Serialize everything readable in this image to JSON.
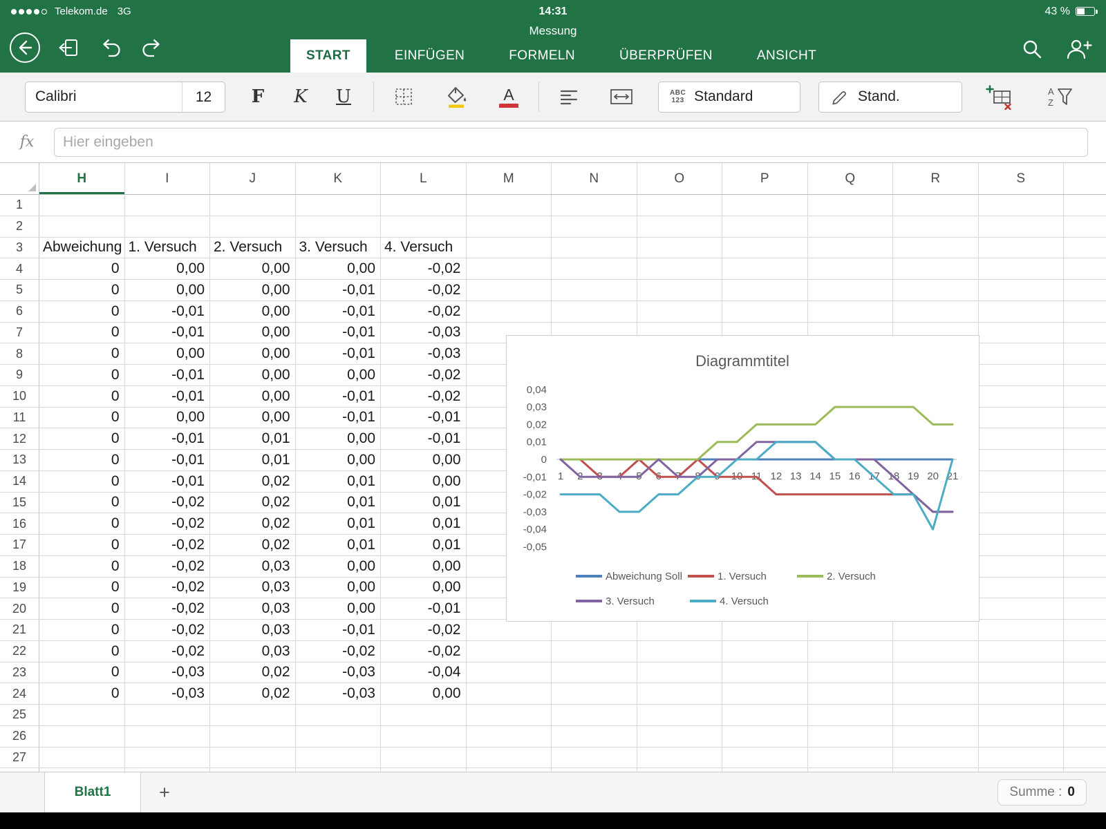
{
  "status_bar": {
    "carrier": "Telekom.de",
    "network": "3G",
    "time": "14:31",
    "battery_percent": "43 %"
  },
  "title_bar": {
    "document_title": "Messung"
  },
  "ribbon": {
    "tabs": [
      {
        "label": "START",
        "active": true
      },
      {
        "label": "EINFÜGEN",
        "active": false
      },
      {
        "label": "FORMELN",
        "active": false
      },
      {
        "label": "ÜBERPRÜFEN",
        "active": false
      },
      {
        "label": "ANSICHT",
        "active": false
      }
    ]
  },
  "toolbar": {
    "font_name": "Calibri",
    "font_size": "12",
    "bold": "F",
    "italic": "K",
    "underline": "U",
    "font_color_letter": "A",
    "font_color_bar": "#d13438",
    "number_format_icon_top": "ABC",
    "number_format_icon_bottom": "123",
    "number_format_label": "Standard",
    "cell_style_label": "Stand.",
    "sort_a": "A",
    "sort_z": "Z"
  },
  "formula_bar": {
    "fx_label": "fx",
    "placeholder": "Hier eingeben"
  },
  "grid": {
    "active_column": "H",
    "columns": [
      "H",
      "I",
      "J",
      "K",
      "L",
      "M",
      "N",
      "O",
      "P",
      "Q",
      "R",
      "S"
    ],
    "rows_visible": 28,
    "table": {
      "header_row": 3,
      "headers": [
        "Abweichung",
        "1. Versuch",
        "2. Versuch",
        "3. Versuch",
        "4. Versuch"
      ],
      "first_data_row": 4,
      "data": [
        [
          "0",
          "0,00",
          "0,00",
          "0,00",
          "-0,02"
        ],
        [
          "0",
          "0,00",
          "0,00",
          "-0,01",
          "-0,02"
        ],
        [
          "0",
          "-0,01",
          "0,00",
          "-0,01",
          "-0,02"
        ],
        [
          "0",
          "-0,01",
          "0,00",
          "-0,01",
          "-0,03"
        ],
        [
          "0",
          "0,00",
          "0,00",
          "-0,01",
          "-0,03"
        ],
        [
          "0",
          "-0,01",
          "0,00",
          "0,00",
          "-0,02"
        ],
        [
          "0",
          "-0,01",
          "0,00",
          "-0,01",
          "-0,02"
        ],
        [
          "0",
          "0,00",
          "0,00",
          "-0,01",
          "-0,01"
        ],
        [
          "0",
          "-0,01",
          "0,01",
          "0,00",
          "-0,01"
        ],
        [
          "0",
          "-0,01",
          "0,01",
          "0,00",
          "0,00"
        ],
        [
          "0",
          "-0,01",
          "0,02",
          "0,01",
          "0,00"
        ],
        [
          "0",
          "-0,02",
          "0,02",
          "0,01",
          "0,01"
        ],
        [
          "0",
          "-0,02",
          "0,02",
          "0,01",
          "0,01"
        ],
        [
          "0",
          "-0,02",
          "0,02",
          "0,01",
          "0,01"
        ],
        [
          "0",
          "-0,02",
          "0,03",
          "0,00",
          "0,00"
        ],
        [
          "0",
          "-0,02",
          "0,03",
          "0,00",
          "0,00"
        ],
        [
          "0",
          "-0,02",
          "0,03",
          "0,00",
          "-0,01"
        ],
        [
          "0",
          "-0,02",
          "0,03",
          "-0,01",
          "-0,02"
        ],
        [
          "0",
          "-0,02",
          "0,03",
          "-0,02",
          "-0,02"
        ],
        [
          "0",
          "-0,03",
          "0,02",
          "-0,03",
          "-0,04"
        ],
        [
          "0",
          "-0,03",
          "0,02",
          "-0,03",
          "0,00"
        ]
      ]
    }
  },
  "chart_data": {
    "type": "line",
    "title": "Diagrammtitel",
    "x": [
      1,
      2,
      3,
      4,
      5,
      6,
      7,
      8,
      9,
      10,
      11,
      12,
      13,
      14,
      15,
      16,
      17,
      18,
      19,
      20,
      21
    ],
    "y_tick_labels": [
      "0,04",
      "0,03",
      "0,02",
      "0,01",
      "0",
      "-0,01",
      "-0,02",
      "-0,03",
      "-0,04",
      "-0,05"
    ],
    "ylim": [
      -0.05,
      0.04
    ],
    "gridlines": "none",
    "legend_position": "bottom",
    "series": [
      {
        "name": "Abweichung Soll",
        "color": "#4F81BD",
        "values": [
          0,
          0,
          0,
          0,
          0,
          0,
          0,
          0,
          0,
          0,
          0,
          0,
          0,
          0,
          0,
          0,
          0,
          0,
          0,
          0,
          0
        ]
      },
      {
        "name": "1. Versuch",
        "color": "#C0504D",
        "values": [
          0,
          0,
          -0.01,
          -0.01,
          0,
          -0.01,
          -0.01,
          0,
          -0.01,
          -0.01,
          -0.01,
          -0.02,
          -0.02,
          -0.02,
          -0.02,
          -0.02,
          -0.02,
          -0.02,
          -0.02,
          -0.03,
          -0.03
        ]
      },
      {
        "name": "2. Versuch",
        "color": "#9BBB59",
        "values": [
          0,
          0,
          0,
          0,
          0,
          0,
          0,
          0,
          0.01,
          0.01,
          0.02,
          0.02,
          0.02,
          0.02,
          0.03,
          0.03,
          0.03,
          0.03,
          0.03,
          0.02,
          0.02
        ]
      },
      {
        "name": "3. Versuch",
        "color": "#8064A2",
        "values": [
          0,
          -0.01,
          -0.01,
          -0.01,
          -0.01,
          0,
          -0.01,
          -0.01,
          0,
          0,
          0.01,
          0.01,
          0.01,
          0.01,
          0,
          0,
          0,
          -0.01,
          -0.02,
          -0.03,
          -0.03
        ]
      },
      {
        "name": "4. Versuch",
        "color": "#4BACC6",
        "values": [
          -0.02,
          -0.02,
          -0.02,
          -0.03,
          -0.03,
          -0.02,
          -0.02,
          -0.01,
          -0.01,
          0,
          0,
          0.01,
          0.01,
          0.01,
          0,
          0,
          -0.01,
          -0.02,
          -0.02,
          -0.04,
          0
        ]
      }
    ]
  },
  "sheet_bar": {
    "active_sheet": "Blatt1",
    "add_sheet": "+",
    "summary_label": "Summe :",
    "summary_value": "0"
  },
  "icons": {
    "signal": "four-of-five-dots",
    "battery": "battery-43-percent",
    "back": "circled-left-arrow",
    "documents": "document-with-back-arrow",
    "undo": "curved-arrow-left",
    "redo": "curved-arrow-right",
    "search": "magnifier",
    "add-person": "person-plus",
    "borders": "dashed-cell-grid",
    "fill": "paint-bucket-yellow-bar",
    "font-color": "letter-A-red-bar",
    "alignment": "left-aligned-lines",
    "merge": "box-with-horizontal-arrows",
    "number-format": "abc-over-123",
    "cell-styles": "pen",
    "insert-delete-cells": "grid-green-plus-red-x",
    "sort-filter": "a-z-funnel",
    "select-all": "corner-triangle",
    "add-sheet": "plus"
  }
}
